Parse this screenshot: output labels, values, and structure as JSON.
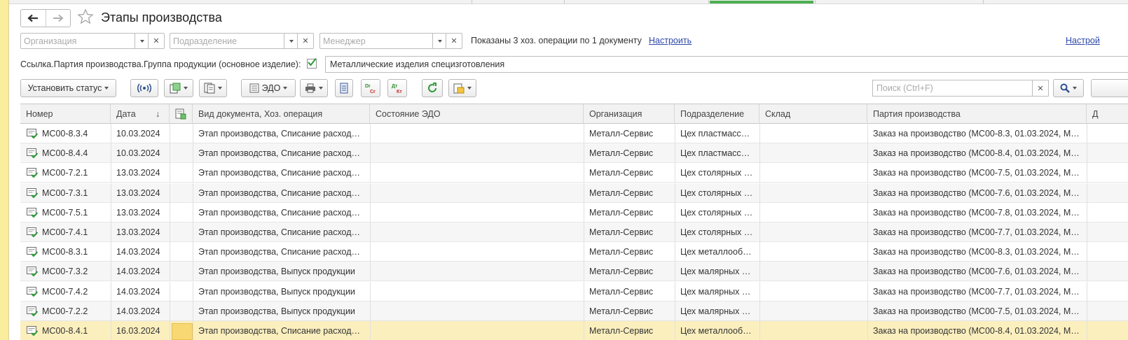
{
  "window": {
    "title": "Этапы производства"
  },
  "filters": {
    "organization_placeholder": "Организация",
    "department_placeholder": "Подразделение",
    "manager_placeholder": "Менеджер",
    "shown_text": "Показаны 3 хоз. операции по 1 документу",
    "configure_link": "Настроить",
    "configure_link_right": "Настрой",
    "group_label": "Ссылка.Партия производства.Группа продукции (основное изделие):",
    "group_value": "Металлические изделия специзготовления"
  },
  "toolbar": {
    "set_status_label": "Установить статус",
    "edo_label": "ЭДО",
    "search_placeholder": "Поиск (Ctrl+F)"
  },
  "table": {
    "columns": [
      "Номер",
      "Дата",
      "Вид документа, Хоз. операция",
      "Состояние ЭДО",
      "Организация",
      "Подразделение",
      "Склад",
      "Партия производства",
      "Д"
    ],
    "sort_indicator": "↓",
    "rows": [
      {
        "number": "МС00-8.3.4",
        "date": "10.03.2024",
        "doc": "Этап производства, Списание расход…",
        "edo": "",
        "org": "Металл-Сервис",
        "dept": "Цех пластмасс…",
        "wh": "",
        "batch": "Заказ на производство (МС00-8.3, 01.03.2024, М…"
      },
      {
        "number": "МС00-8.4.4",
        "date": "10.03.2024",
        "doc": "Этап производства, Списание расход…",
        "edo": "",
        "org": "Металл-Сервис",
        "dept": "Цех пластмасс…",
        "wh": "",
        "batch": "Заказ на производство (МС00-8.4, 01.03.2024, М…"
      },
      {
        "number": "МС00-7.2.1",
        "date": "13.03.2024",
        "doc": "Этап производства, Списание расход…",
        "edo": "",
        "org": "Металл-Сервис",
        "dept": "Цех столярных …",
        "wh": "",
        "batch": "Заказ на производство (МС00-7.5, 01.03.2024, М…"
      },
      {
        "number": "МС00-7.3.1",
        "date": "13.03.2024",
        "doc": "Этап производства, Списание расход…",
        "edo": "",
        "org": "Металл-Сервис",
        "dept": "Цех столярных …",
        "wh": "",
        "batch": "Заказ на производство (МС00-7.6, 01.03.2024, М…"
      },
      {
        "number": "МС00-7.5.1",
        "date": "13.03.2024",
        "doc": "Этап производства, Списание расход…",
        "edo": "",
        "org": "Металл-Сервис",
        "dept": "Цех столярных …",
        "wh": "",
        "batch": "Заказ на производство (МС00-7.8, 01.03.2024, М…"
      },
      {
        "number": "МС00-7.4.1",
        "date": "13.03.2024",
        "doc": "Этап производства, Списание расход…",
        "edo": "",
        "org": "Металл-Сервис",
        "dept": "Цех столярных …",
        "wh": "",
        "batch": "Заказ на производство (МС00-7.7, 01.03.2024, М…"
      },
      {
        "number": "МС00-8.3.1",
        "date": "14.03.2024",
        "doc": "Этап производства, Списание расход…",
        "edo": "",
        "org": "Металл-Сервис",
        "dept": "Цех металлооб…",
        "wh": "",
        "batch": "Заказ на производство (МС00-8.3, 01.03.2024, М…"
      },
      {
        "number": "МС00-7.3.2",
        "date": "14.03.2024",
        "doc": "Этап производства, Выпуск продукции",
        "edo": "",
        "org": "Металл-Сервис",
        "dept": "Цех малярных …",
        "wh": "",
        "batch": "Заказ на производство (МС00-7.6, 01.03.2024, М…"
      },
      {
        "number": "МС00-7.4.2",
        "date": "14.03.2024",
        "doc": "Этап производства, Выпуск продукции",
        "edo": "",
        "org": "Металл-Сервис",
        "dept": "Цех малярных …",
        "wh": "",
        "batch": "Заказ на производство (МС00-7.7, 01.03.2024, М…"
      },
      {
        "number": "МС00-7.2.2",
        "date": "14.03.2024",
        "doc": "Этап производства, Выпуск продукции",
        "edo": "",
        "org": "Металл-Сервис",
        "dept": "Цех малярных …",
        "wh": "",
        "batch": "Заказ на производство (МС00-7.5, 01.03.2024, М…"
      },
      {
        "number": "МС00-8.4.1",
        "date": "16.03.2024",
        "doc": "Этап производства, Списание расход…",
        "edo": "",
        "org": "Металл-Сервис",
        "dept": "Цех металлооб…",
        "wh": "",
        "batch": "Заказ на производство (МС00-8.4, 01.03.2024, М…"
      }
    ]
  }
}
